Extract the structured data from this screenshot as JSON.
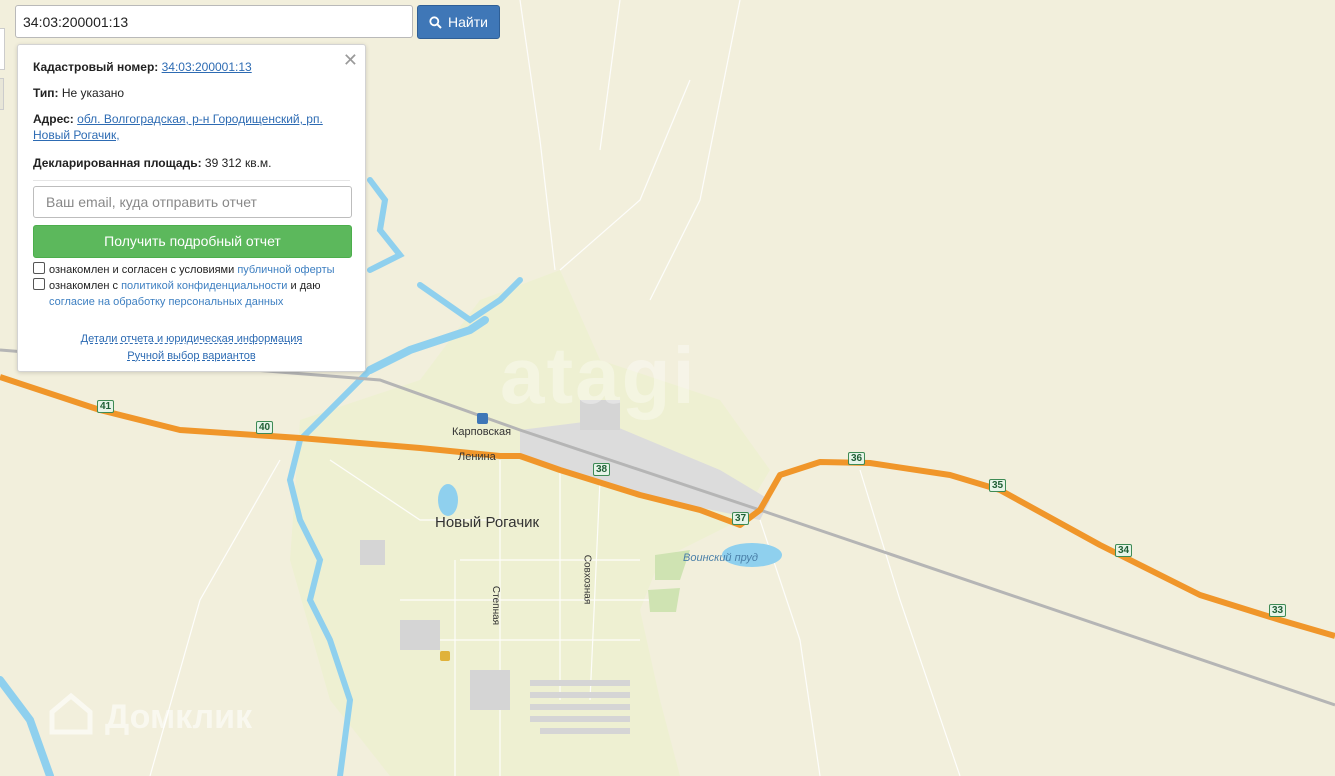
{
  "search": {
    "value": "34:03:200001:13",
    "button_label": "Найти"
  },
  "popup": {
    "cadastral_label": "Кадастровый номер:",
    "cadastral_value": "34:03:200001:13",
    "type_label": "Тип:",
    "type_value": "Не указано",
    "address_label": "Адрес:",
    "address_line1": "обл. Волгоградская, р-н Городищенский, рп.",
    "address_line2": "Новый Рогачик,",
    "area_label": "Декларированная площадь:",
    "area_value": "39 312 кв.м.",
    "email_placeholder": "Ваш email, куда отправить отчет",
    "report_button": "Получить подробный отчет",
    "consent1_text": "ознакомлен и согласен с условиями",
    "consent1_link": "публичной оферты",
    "consent2_text_a": "ознакомлен с",
    "consent2_link_a": "политикой конфиденциальности",
    "consent2_text_b": "и даю",
    "consent2_link_b": "согласие на обработку персональных данных",
    "details_link": "Детали отчета и юридическая информация",
    "manual_link": "Ручной выбор вариантов"
  },
  "map": {
    "labels": {
      "town": "Новый Рогачик",
      "station": "Карповская",
      "street_lenina": "Ленина",
      "street_stepnaya": "Степная",
      "street_sovkhoznaya": "Совхозная",
      "pond": "Воинский пруд"
    },
    "km_markers": [
      "41",
      "40",
      "38",
      "37",
      "36",
      "35",
      "34",
      "33"
    ],
    "watermarks": {
      "cian": "atagi",
      "domclick": "Домклик"
    },
    "colors": {
      "background": "#f2efdc",
      "town_area": "#eef0d2",
      "water": "#8fd0ee",
      "highway": "#f0962a",
      "railway": "#b5b5b5"
    }
  }
}
